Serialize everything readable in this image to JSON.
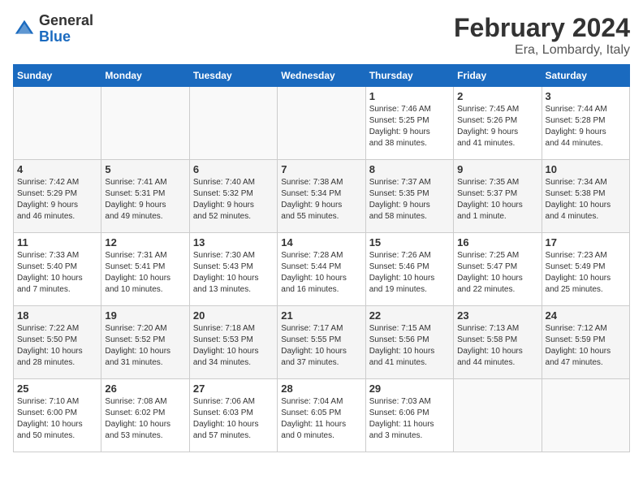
{
  "header": {
    "logo_general": "General",
    "logo_blue": "Blue",
    "title": "February 2024",
    "subtitle": "Era, Lombardy, Italy"
  },
  "columns": [
    "Sunday",
    "Monday",
    "Tuesday",
    "Wednesday",
    "Thursday",
    "Friday",
    "Saturday"
  ],
  "weeks": [
    [
      {
        "day": "",
        "info": ""
      },
      {
        "day": "",
        "info": ""
      },
      {
        "day": "",
        "info": ""
      },
      {
        "day": "",
        "info": ""
      },
      {
        "day": "1",
        "info": "Sunrise: 7:46 AM\nSunset: 5:25 PM\nDaylight: 9 hours\nand 38 minutes."
      },
      {
        "day": "2",
        "info": "Sunrise: 7:45 AM\nSunset: 5:26 PM\nDaylight: 9 hours\nand 41 minutes."
      },
      {
        "day": "3",
        "info": "Sunrise: 7:44 AM\nSunset: 5:28 PM\nDaylight: 9 hours\nand 44 minutes."
      }
    ],
    [
      {
        "day": "4",
        "info": "Sunrise: 7:42 AM\nSunset: 5:29 PM\nDaylight: 9 hours\nand 46 minutes."
      },
      {
        "day": "5",
        "info": "Sunrise: 7:41 AM\nSunset: 5:31 PM\nDaylight: 9 hours\nand 49 minutes."
      },
      {
        "day": "6",
        "info": "Sunrise: 7:40 AM\nSunset: 5:32 PM\nDaylight: 9 hours\nand 52 minutes."
      },
      {
        "day": "7",
        "info": "Sunrise: 7:38 AM\nSunset: 5:34 PM\nDaylight: 9 hours\nand 55 minutes."
      },
      {
        "day": "8",
        "info": "Sunrise: 7:37 AM\nSunset: 5:35 PM\nDaylight: 9 hours\nand 58 minutes."
      },
      {
        "day": "9",
        "info": "Sunrise: 7:35 AM\nSunset: 5:37 PM\nDaylight: 10 hours\nand 1 minute."
      },
      {
        "day": "10",
        "info": "Sunrise: 7:34 AM\nSunset: 5:38 PM\nDaylight: 10 hours\nand 4 minutes."
      }
    ],
    [
      {
        "day": "11",
        "info": "Sunrise: 7:33 AM\nSunset: 5:40 PM\nDaylight: 10 hours\nand 7 minutes."
      },
      {
        "day": "12",
        "info": "Sunrise: 7:31 AM\nSunset: 5:41 PM\nDaylight: 10 hours\nand 10 minutes."
      },
      {
        "day": "13",
        "info": "Sunrise: 7:30 AM\nSunset: 5:43 PM\nDaylight: 10 hours\nand 13 minutes."
      },
      {
        "day": "14",
        "info": "Sunrise: 7:28 AM\nSunset: 5:44 PM\nDaylight: 10 hours\nand 16 minutes."
      },
      {
        "day": "15",
        "info": "Sunrise: 7:26 AM\nSunset: 5:46 PM\nDaylight: 10 hours\nand 19 minutes."
      },
      {
        "day": "16",
        "info": "Sunrise: 7:25 AM\nSunset: 5:47 PM\nDaylight: 10 hours\nand 22 minutes."
      },
      {
        "day": "17",
        "info": "Sunrise: 7:23 AM\nSunset: 5:49 PM\nDaylight: 10 hours\nand 25 minutes."
      }
    ],
    [
      {
        "day": "18",
        "info": "Sunrise: 7:22 AM\nSunset: 5:50 PM\nDaylight: 10 hours\nand 28 minutes."
      },
      {
        "day": "19",
        "info": "Sunrise: 7:20 AM\nSunset: 5:52 PM\nDaylight: 10 hours\nand 31 minutes."
      },
      {
        "day": "20",
        "info": "Sunrise: 7:18 AM\nSunset: 5:53 PM\nDaylight: 10 hours\nand 34 minutes."
      },
      {
        "day": "21",
        "info": "Sunrise: 7:17 AM\nSunset: 5:55 PM\nDaylight: 10 hours\nand 37 minutes."
      },
      {
        "day": "22",
        "info": "Sunrise: 7:15 AM\nSunset: 5:56 PM\nDaylight: 10 hours\nand 41 minutes."
      },
      {
        "day": "23",
        "info": "Sunrise: 7:13 AM\nSunset: 5:58 PM\nDaylight: 10 hours\nand 44 minutes."
      },
      {
        "day": "24",
        "info": "Sunrise: 7:12 AM\nSunset: 5:59 PM\nDaylight: 10 hours\nand 47 minutes."
      }
    ],
    [
      {
        "day": "25",
        "info": "Sunrise: 7:10 AM\nSunset: 6:00 PM\nDaylight: 10 hours\nand 50 minutes."
      },
      {
        "day": "26",
        "info": "Sunrise: 7:08 AM\nSunset: 6:02 PM\nDaylight: 10 hours\nand 53 minutes."
      },
      {
        "day": "27",
        "info": "Sunrise: 7:06 AM\nSunset: 6:03 PM\nDaylight: 10 hours\nand 57 minutes."
      },
      {
        "day": "28",
        "info": "Sunrise: 7:04 AM\nSunset: 6:05 PM\nDaylight: 11 hours\nand 0 minutes."
      },
      {
        "day": "29",
        "info": "Sunrise: 7:03 AM\nSunset: 6:06 PM\nDaylight: 11 hours\nand 3 minutes."
      },
      {
        "day": "",
        "info": ""
      },
      {
        "day": "",
        "info": ""
      }
    ]
  ]
}
